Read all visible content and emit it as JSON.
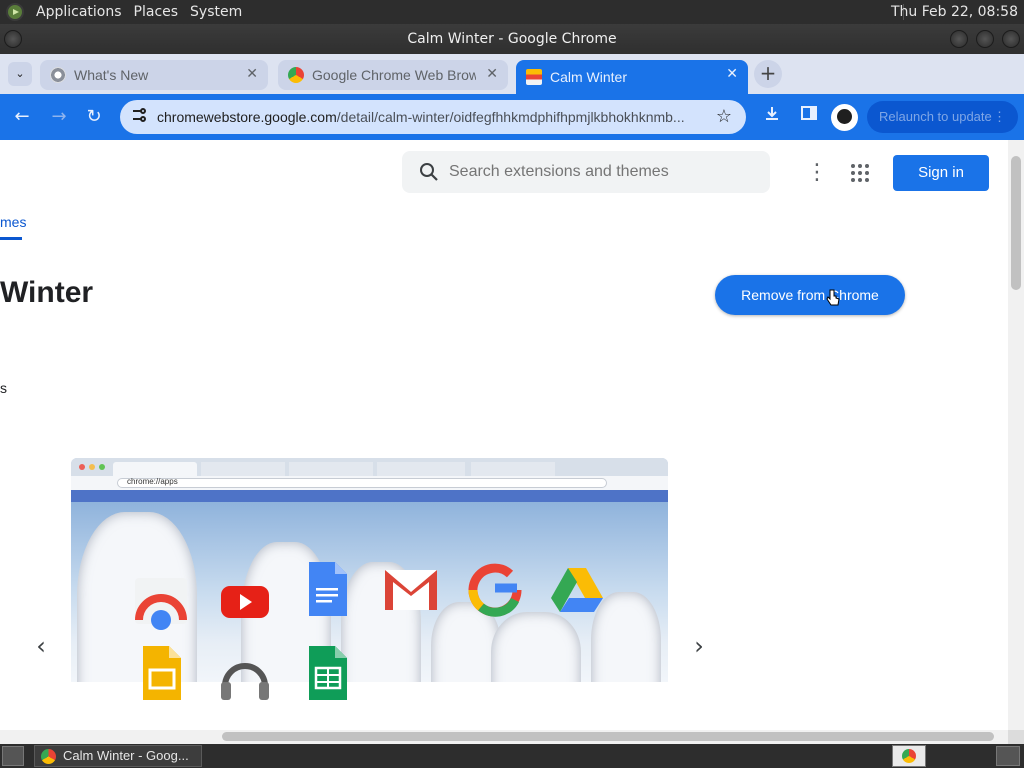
{
  "top_panel": {
    "menus": [
      "Applications",
      "Places",
      "System"
    ],
    "clock": "Thu Feb 22, 08:58"
  },
  "window": {
    "title": "Calm Winter - Google Chrome"
  },
  "tabs": [
    {
      "title": "What's New",
      "active": false,
      "icon": "chrome-icon"
    },
    {
      "title": "Google Chrome Web Browser",
      "active": false,
      "icon": "google-chrome-icon"
    },
    {
      "title": "Calm Winter",
      "active": true,
      "icon": "web-store-icon"
    }
  ],
  "toolbar": {
    "url_host": "chromewebstore.google.com",
    "url_path": "/detail/calm-winter/oidfegfhhkmdphifhpmjlkbhokhknmb...",
    "relaunch_label": "Relaunch to update",
    "back_icon": "arrow-left-icon",
    "forward_icon": "arrow-right-icon",
    "reload_icon": "reload-icon",
    "bookmark_icon": "star-icon",
    "download_icon": "download-icon",
    "side_panel_icon": "side-panel-icon",
    "profile_icon": "profile-icon"
  },
  "store": {
    "search_placeholder": "Search extensions and themes",
    "sign_in_label": "Sign in",
    "nav_tab": "mes",
    "title": "Winter",
    "small_text": "s",
    "action_button": "Remove from Chrome"
  },
  "preview": {
    "address": "chrome://apps"
  },
  "taskbar": {
    "task_label": "Calm Winter - Goog..."
  },
  "colors": {
    "accent": "#1a73e8",
    "tab_active": "#1a73e8",
    "tabstrip": "#dde3f1"
  }
}
